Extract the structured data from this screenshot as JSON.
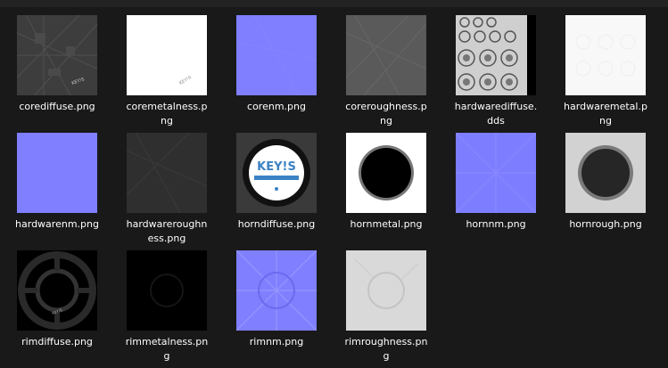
{
  "files": [
    {
      "name": "corediffuse.png",
      "label_lines": [
        "corediffuse.png"
      ],
      "thumb": "core-diffuse"
    },
    {
      "name": "coremetalness.png",
      "label_lines": [
        "coremetalness.p",
        "ng"
      ],
      "thumb": "core-metalness"
    },
    {
      "name": "corenm.png",
      "label_lines": [
        "corenm.png"
      ],
      "thumb": "normal-map"
    },
    {
      "name": "coreroughness.png",
      "label_lines": [
        "coreroughness.p",
        "ng"
      ],
      "thumb": "core-roughness"
    },
    {
      "name": "hardwarediffuse.dds",
      "label_lines": [
        "hardwarediffuse.",
        "dds"
      ],
      "thumb": "hardware-diffuse"
    },
    {
      "name": "hardwaremetal.png",
      "label_lines": [
        "hardwaremetal.p",
        "ng"
      ],
      "thumb": "hardware-metal"
    },
    {
      "name": "hardwarenm.png",
      "label_lines": [
        "hardwarenm.png"
      ],
      "thumb": "normal-map"
    },
    {
      "name": "hardwareroughness.png",
      "label_lines": [
        "hardwareroughn",
        "ess.png"
      ],
      "thumb": "hardware-roughness"
    },
    {
      "name": "horndiffuse.png",
      "label_lines": [
        "horndiffuse.png"
      ],
      "thumb": "horn-diffuse",
      "logo_text": "KEY!S"
    },
    {
      "name": "hornmetal.png",
      "label_lines": [
        "hornmetal.png"
      ],
      "thumb": "horn-metal"
    },
    {
      "name": "hornnm.png",
      "label_lines": [
        "hornnm.png"
      ],
      "thumb": "horn-normal"
    },
    {
      "name": "hornrough.png",
      "label_lines": [
        "hornrough.png"
      ],
      "thumb": "horn-rough"
    },
    {
      "name": "rimdiffuse.png",
      "label_lines": [
        "rimdiffuse.png"
      ],
      "thumb": "rim-diffuse"
    },
    {
      "name": "rimmetalness.png",
      "label_lines": [
        "rimmetalness.pn",
        "g"
      ],
      "thumb": "rim-metalness"
    },
    {
      "name": "rimnm.png",
      "label_lines": [
        "rimnm.png"
      ],
      "thumb": "rim-normal"
    },
    {
      "name": "rimroughness.png",
      "label_lines": [
        "rimroughness.pn",
        "g"
      ],
      "thumb": "rim-roughness"
    }
  ],
  "colors": {
    "background": "#191919",
    "label": "#ffffff",
    "normal_map": "#8080ff"
  }
}
